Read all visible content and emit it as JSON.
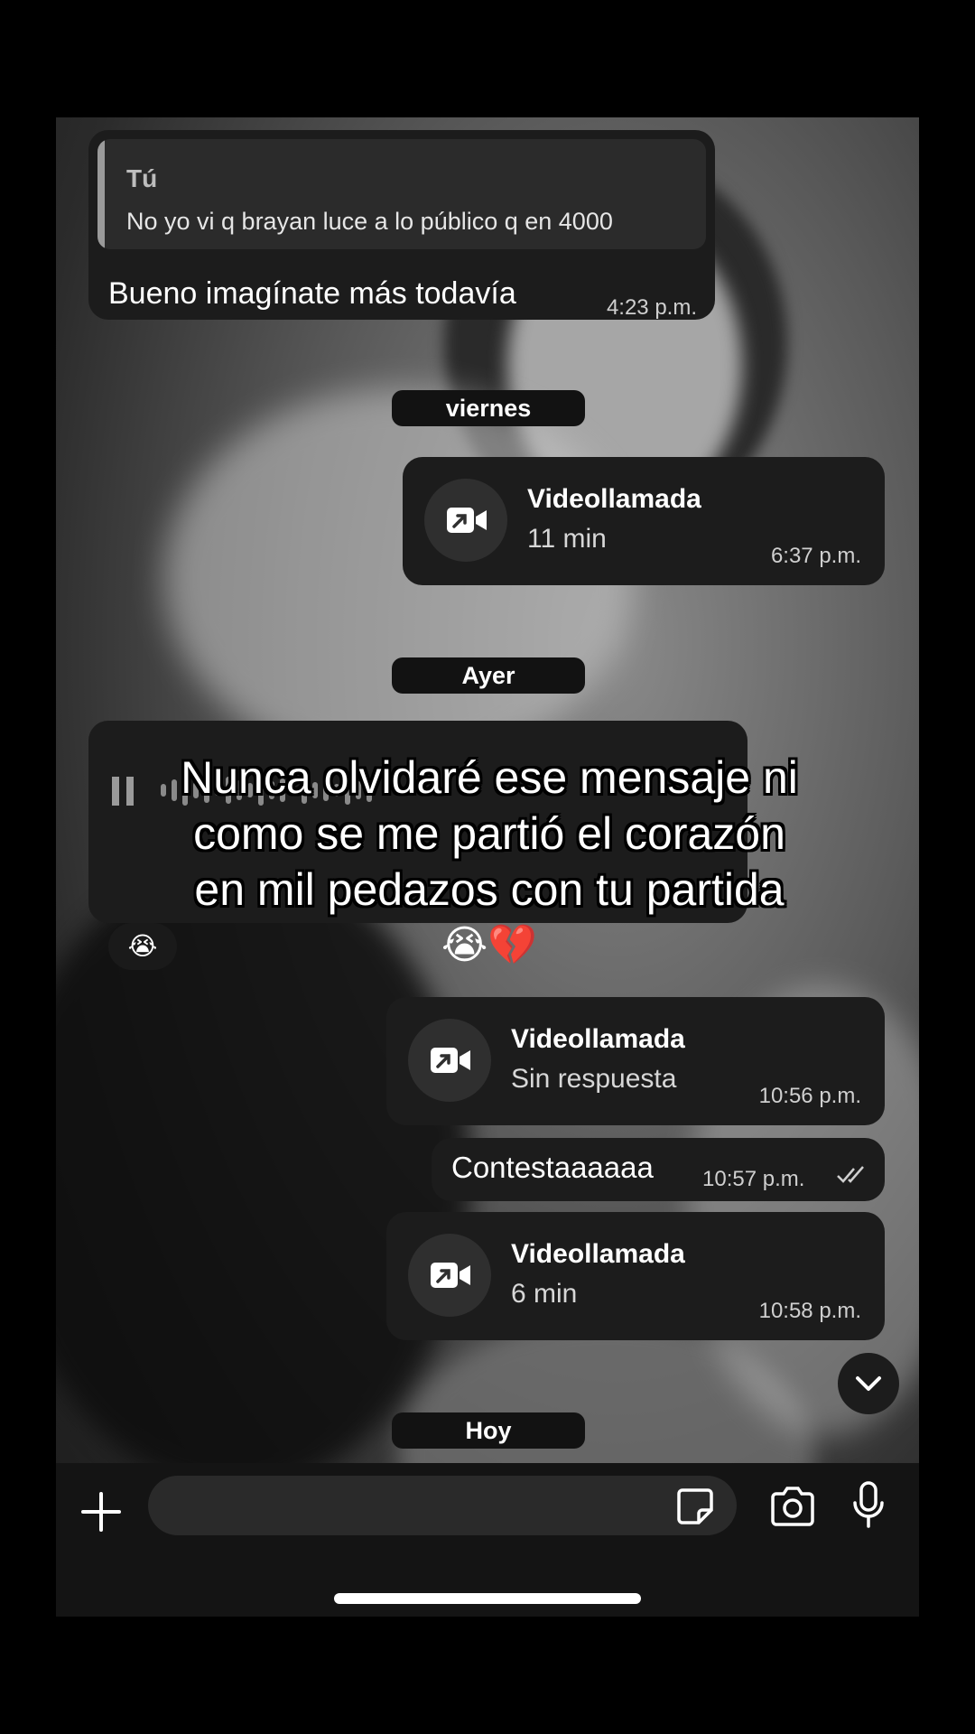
{
  "chat": {
    "quoted_message": {
      "author": "Tú",
      "quote": "No yo vi q brayan luce a lo público q en 4000",
      "text": "Bueno imagínate más todavía",
      "time": "4:23 p.m."
    },
    "days": {
      "friday": "viernes",
      "yesterday": "Ayer",
      "today": "Hoy"
    },
    "calls": [
      {
        "title": "Videollamada",
        "detail": "11 min",
        "time": "6:37 p.m."
      },
      {
        "title": "Videollamada",
        "detail": "Sin respuesta",
        "time": "10:56 p.m."
      },
      {
        "title": "Videollamada",
        "detail": "6 min",
        "time": "10:58 p.m."
      }
    ],
    "sent_text": {
      "text": "Contestaaaaaa",
      "time": "10:57 p.m."
    },
    "reaction": "😭",
    "caption_line1": "Nunca olvidaré ese mensaje ni",
    "caption_line2": "como se me partió el corazón",
    "caption_line3": "en mil pedazos con tu partida",
    "caption_emoji": "😭💔"
  },
  "input": {
    "placeholder": ""
  },
  "icons": {
    "call": "video-call-outgoing-icon",
    "plus": "plus-icon",
    "sticker": "sticker-icon",
    "camera": "camera-icon",
    "mic": "microphone-icon",
    "scroll": "chevron-down-icon",
    "ticks": "double-check-icon"
  }
}
